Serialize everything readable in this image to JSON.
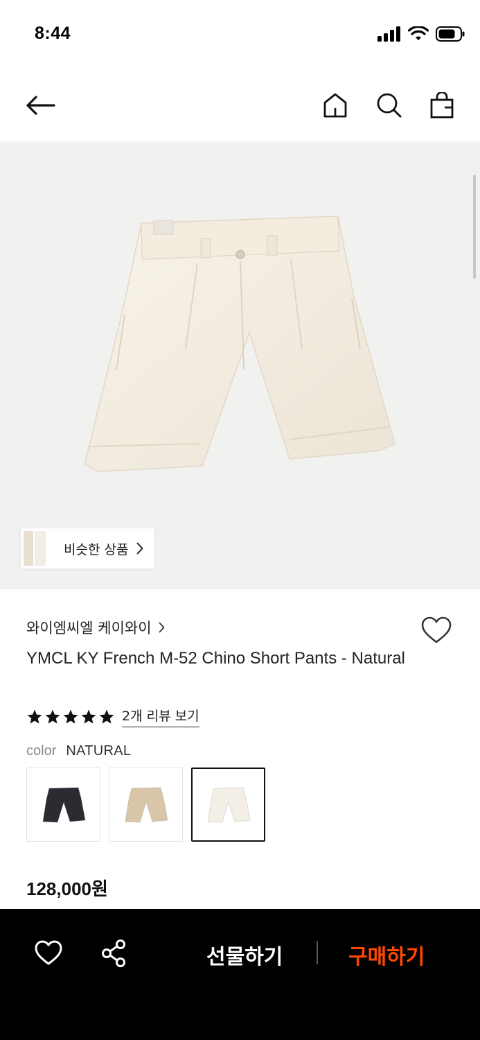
{
  "status_bar": {
    "time": "8:44"
  },
  "icons": {
    "back": "arrow-left-icon",
    "home": "home-icon",
    "search": "search-icon",
    "bag": "shopping-bag-icon",
    "wishlist": "heart-icon",
    "share": "share-icon"
  },
  "similar": {
    "label": "비슷한 상품"
  },
  "product": {
    "brand": "와이엠씨엘 케이와이",
    "title": "YMCL KY French M-52 Chino Short Pants - Natural",
    "rating": 5,
    "review_link": "2개 리뷰 보기",
    "color_label": "color",
    "color_value": "NATURAL",
    "price": "128,000원",
    "swatches": [
      {
        "name": "black",
        "color": "#2a2c31"
      },
      {
        "name": "beige",
        "color": "#d9c5a8"
      },
      {
        "name": "natural",
        "color": "#f3efe6"
      }
    ],
    "selected_swatch": 2
  },
  "bottom_bar": {
    "gift_label": "선물하기",
    "buy_label": "구매하기"
  },
  "colors": {
    "accent": "#ff4800",
    "bottom_bar_bg": "#000000"
  }
}
